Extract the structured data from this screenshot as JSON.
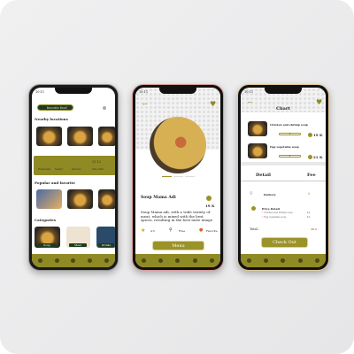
{
  "home": {
    "status_time": "10:11",
    "search_placeholder": "favorite food",
    "nearby_title": "Nearby locations",
    "quick": [
      "Restaurant",
      "Nearby",
      "Delivery",
      "Dine Until"
    ],
    "quick_value": "12.12",
    "popular_title": "Popular and favorite",
    "categories_title": "Categories",
    "categories": [
      "Soup",
      "Meat",
      "Drinks"
    ],
    "nav": [
      "Home",
      "Search",
      "Orders",
      "Inbox",
      "Account"
    ]
  },
  "detail": {
    "status_time": "10:11",
    "title": "Soup Mama Adi",
    "price": "19 K",
    "description": "Soup Mama adi, with a wide variety of meat, which is mixed with the best spices, resulting in the best taste image",
    "rating": "4.5",
    "delivery": "Free",
    "favorite": "Favorite",
    "button": "Menu"
  },
  "cart": {
    "status_time": "10:11",
    "title": "Chart",
    "items": [
      {
        "name": "Chicken and shrimp soup",
        "qty": "1",
        "price": "19 K"
      },
      {
        "name": "Egg vegetable soup",
        "qty": "1",
        "price": "21 K"
      }
    ],
    "detail_label": "Detail",
    "fee_label": "Fee",
    "delivery_label": "Delivery",
    "delivery_fee": "0",
    "price_detail_label": "Price Detail",
    "lines": [
      {
        "name": "Chicken and shrimp soup",
        "qty": "1x"
      },
      {
        "name": "Egg vegetable soup",
        "qty": "1x"
      }
    ],
    "total_label": "Total :",
    "total": "40 k",
    "button": "Check Out"
  },
  "colors": {
    "olive": "#8f8a24",
    "dark_green": "#1e3a1e"
  }
}
